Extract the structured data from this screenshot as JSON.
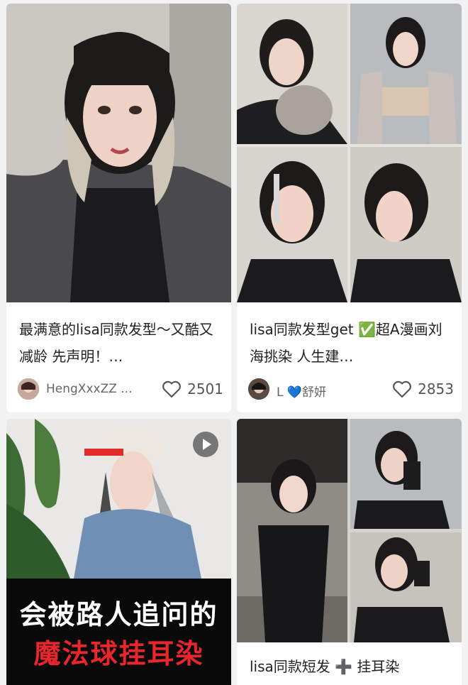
{
  "cards": [
    {
      "title": "最满意的lisa同款发型～又酷又减龄 先声明！…",
      "author": "HengXxxZZ ...",
      "likes": "2501"
    },
    {
      "title": "lisa同款发型get ✅超A漫画刘海挑染 人生建…",
      "author": "L 💙舒妍",
      "likes": "2853"
    },
    {
      "overlay_line1": "会被路人追问的",
      "overlay_line2": "魔法球挂耳染",
      "is_video": true
    },
    {
      "title": "lisa同款短发 ➕ 挂耳染"
    }
  ],
  "colors": {
    "background": "#f2f2f2",
    "card": "#ffffff",
    "overlay_line2": "#e8262b",
    "overlay_line1": "#ffffff"
  },
  "icons": {
    "like": "heart-outline-icon",
    "play": "play-icon"
  }
}
